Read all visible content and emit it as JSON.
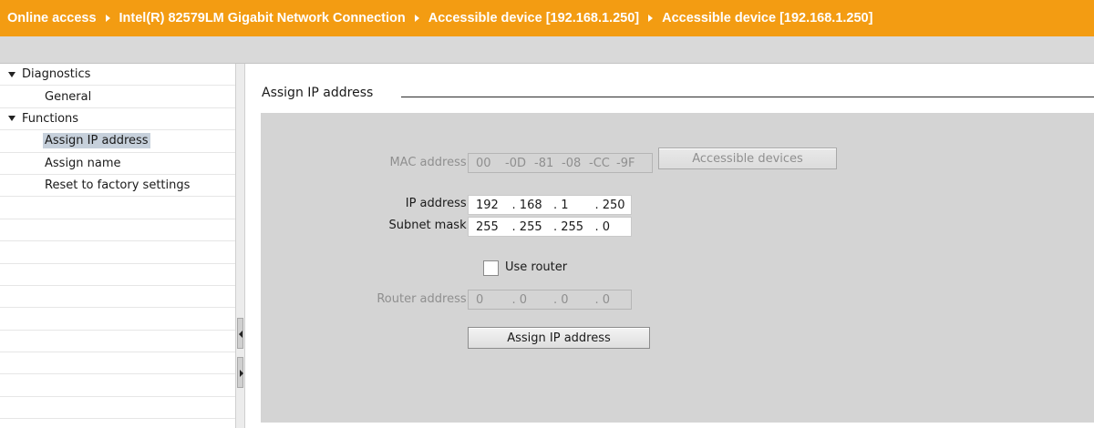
{
  "breadcrumb": {
    "items": [
      "Online access",
      "Intel(R) 82579LM Gigabit Network Connection",
      "Accessible device [192.168.1.250]",
      "Accessible device [192.168.1.250]"
    ]
  },
  "nav": {
    "items": [
      {
        "label": "Diagnostics",
        "level": 0,
        "expanded": true
      },
      {
        "label": "General",
        "level": 1
      },
      {
        "label": "Functions",
        "level": 0,
        "expanded": true
      },
      {
        "label": "Assign IP address",
        "level": 1,
        "selected": true
      },
      {
        "label": "Assign name",
        "level": 1
      },
      {
        "label": "Reset to factory settings",
        "level": 1
      }
    ]
  },
  "main": {
    "section_title": "Assign IP address",
    "mac": {
      "label": "MAC address:",
      "octets": [
        "00",
        "-0D",
        "-81",
        "-08",
        "-CC",
        "-9F"
      ],
      "button_label": "Accessible devices"
    },
    "ip": {
      "label": "IP address:",
      "octets": [
        "192",
        ". 168",
        ". 1",
        ". 250"
      ]
    },
    "subnet": {
      "label": "Subnet mask:",
      "octets": [
        "255",
        ". 255",
        ". 255",
        ". 0"
      ]
    },
    "use_router": {
      "label": "Use router",
      "checked": false
    },
    "router": {
      "label": "Router address:",
      "octets": [
        "0",
        ". 0",
        ". 0",
        ". 0"
      ]
    },
    "assign_button_label": "Assign IP address"
  },
  "colors": {
    "titlebar": "#f39c12",
    "panel": "#d4d4d4",
    "selection": "#c6d0db"
  }
}
